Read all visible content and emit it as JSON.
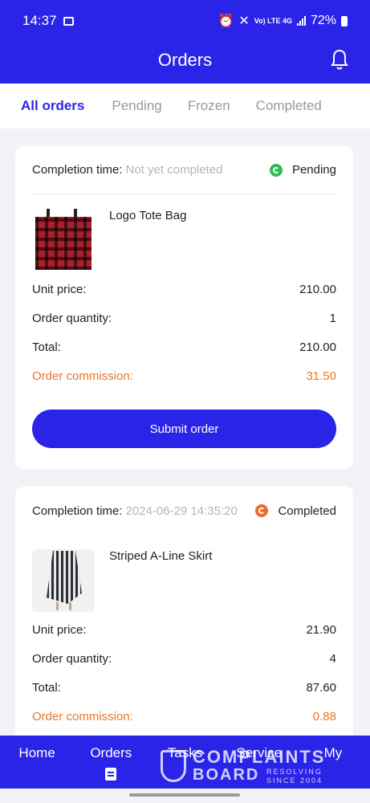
{
  "status_bar": {
    "time": "14:37",
    "battery": "72%",
    "network": "Vo) LTE 4G"
  },
  "header": {
    "title": "Orders"
  },
  "tabs": [
    {
      "label": "All orders",
      "active": true
    },
    {
      "label": "Pending",
      "active": false
    },
    {
      "label": "Frozen",
      "active": false
    },
    {
      "label": "Completed",
      "active": false
    }
  ],
  "orders": [
    {
      "completion_label": "Completion time:",
      "completion_value": "Not yet completed",
      "status": "Pending",
      "status_color": "#2dbb55",
      "product_name": "Logo Tote Bag",
      "unit_price_label": "Unit price:",
      "unit_price": "210.00",
      "quantity_label": "Order quantity:",
      "quantity": "1",
      "total_label": "Total:",
      "total": "210.00",
      "commission_label": "Order commission:",
      "commission": "31.50",
      "submit_label": "Submit order"
    },
    {
      "completion_label": "Completion time:",
      "completion_value": "2024-06-29 14:35:20",
      "status": "Completed",
      "status_color": "#f06a28",
      "product_name": "Striped A-Line Skirt",
      "unit_price_label": "Unit price:",
      "unit_price": "21.90",
      "quantity_label": "Order quantity:",
      "quantity": "4",
      "total_label": "Total:",
      "total": "87.60",
      "commission_label": "Order commission:",
      "commission": "0.88"
    }
  ],
  "bottom_nav": [
    {
      "label": "Home"
    },
    {
      "label": "Orders",
      "active": true
    },
    {
      "label": "Tasks"
    },
    {
      "label": "Service"
    },
    {
      "label": "My"
    }
  ],
  "watermark": {
    "line1": "COMPLAINTS",
    "line2": "BOARD",
    "tagline": "RESOLVING SINCE 2004"
  },
  "colors": {
    "brand": "#2a24e8",
    "commission": "#e8762a",
    "background": "#f2f3f7"
  }
}
